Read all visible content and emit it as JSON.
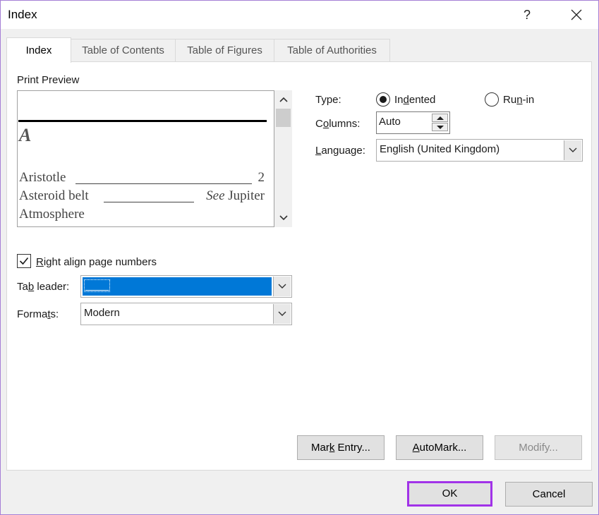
{
  "window": {
    "title": "Index",
    "help": "?"
  },
  "tabs": [
    {
      "label": "Index",
      "active": true
    },
    {
      "label": "Table of Contents",
      "active": false
    },
    {
      "label": "Table of Figures",
      "active": false
    },
    {
      "label": "Table of Authorities",
      "active": false
    }
  ],
  "preview": {
    "label": "Print Preview",
    "letter": "A",
    "entries": [
      {
        "text": "Aristotle",
        "page": "2"
      },
      {
        "text": "Asteroid belt",
        "see_word": "See",
        "see_target": "Jupiter"
      },
      {
        "text": "Atmosphere"
      }
    ]
  },
  "options": {
    "right_align_label": "Right align page numbers",
    "right_align_checked": true,
    "tab_leader_label": "Tab leader:",
    "tab_leader_value": "____",
    "formats_label": "Formats:",
    "formats_value": "Modern"
  },
  "type": {
    "label": "Type:",
    "indented_label": "Indented",
    "runin_label": "Run-in",
    "selected": "Indented"
  },
  "columns": {
    "label": "Columns:",
    "value": "Auto"
  },
  "language": {
    "label": "Language:",
    "value": "English (United Kingdom)"
  },
  "actions": {
    "mark_entry": "Mark Entry...",
    "automark": "AutoMark...",
    "modify": "Modify..."
  },
  "footer": {
    "ok": "OK",
    "cancel": "Cancel"
  },
  "colors": {
    "accent_highlight": "#0078d7",
    "ok_focus_border": "#a133e8"
  }
}
